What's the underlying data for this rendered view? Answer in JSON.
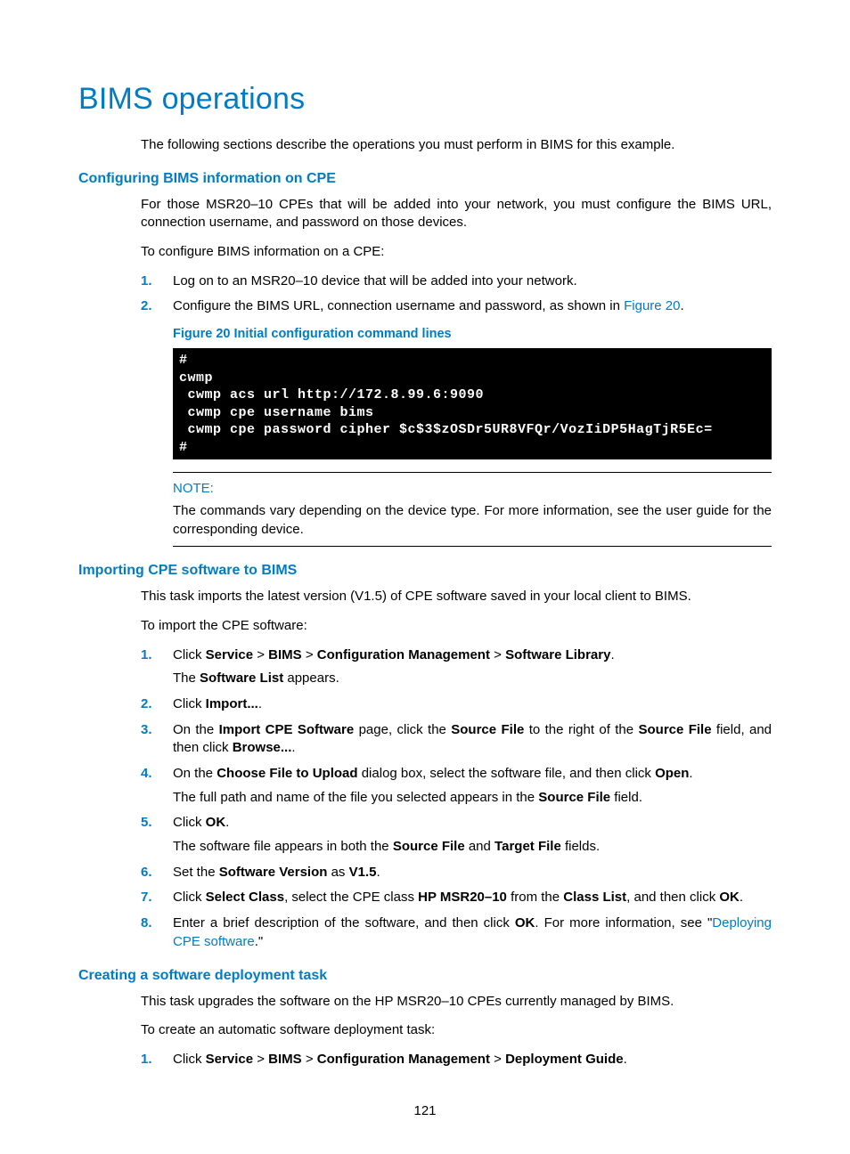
{
  "title": "BIMS operations",
  "intro": "The following sections describe the operations you must perform in BIMS for this example.",
  "sec1": {
    "heading": "Configuring BIMS information on CPE",
    "p1": "For those MSR20–10 CPEs that will be added into your network, you must configure the BIMS URL, connection username, and password on those devices.",
    "p2": "To configure BIMS information on a CPE:",
    "li1": "Log on to an MSR20–10 device that will be added into your network.",
    "li2_pre": "Configure the BIMS URL, connection username and password, as shown in ",
    "li2_link": "Figure 20",
    "li2_post": ".",
    "fig_caption": "Figure 20 Initial configuration command lines",
    "terminal": "#\ncwmp\n cwmp acs url http://172.8.99.6:9090\n cwmp cpe username bims\n cwmp cpe password cipher $c$3$zOSDr5UR8VFQr/VozIiDP5HagTjR5Ec=\n#",
    "note_label": "NOTE:",
    "note_text": "The commands vary depending on the device type. For more information, see the user guide for the corresponding device."
  },
  "sec2": {
    "heading": "Importing CPE software to BIMS",
    "p1": "This task imports the latest version (V1.5) of CPE software saved in your local client to BIMS.",
    "p2": "To import the CPE software:",
    "li1": {
      "pre": "Click ",
      "b1": "Service",
      "s1": " > ",
      "b2": "BIMS",
      "s2": " > ",
      "b3": "Configuration Management",
      "s3": " > ",
      "b4": "Software Library",
      "post": ".",
      "sub_pre": "The ",
      "sub_b": "Software List",
      "sub_post": " appears."
    },
    "li2": {
      "pre": "Click ",
      "b1": "Import...",
      "post": "."
    },
    "li3": {
      "pre": "On the ",
      "b1": "Import CPE Software",
      "mid1": " page, click the ",
      "b2": "Source File",
      "mid2": " to the right of the ",
      "b3": "Source File",
      "mid3": " field, and then click ",
      "b4": "Browse...",
      "post": "."
    },
    "li4": {
      "pre": "On the ",
      "b1": "Choose File to Upload",
      "mid1": " dialog box, select the software file, and then click ",
      "b2": "Open",
      "post": ".",
      "sub_pre": "The full path and name of the file you selected appears in the ",
      "sub_b": "Source File",
      "sub_post": " field."
    },
    "li5": {
      "pre": "Click ",
      "b1": "OK",
      "post": ".",
      "sub_pre": "The software file appears in both the ",
      "sub_b1": "Source File",
      "sub_mid": " and ",
      "sub_b2": "Target File",
      "sub_post": " fields."
    },
    "li6": {
      "pre": "Set the ",
      "b1": "Software Version",
      "mid": " as ",
      "b2": "V1.5",
      "post": "."
    },
    "li7": {
      "pre": "Click ",
      "b1": "Select Class",
      "mid1": ", select the CPE class ",
      "b2": "HP MSR20–10",
      "mid2": " from the ",
      "b3": "Class List",
      "mid3": ", and then click ",
      "b4": "OK",
      "post": "."
    },
    "li8": {
      "pre": "Enter a brief description of the software, and then click ",
      "b1": "OK",
      "mid": ". For more information, see \"",
      "link": "Deploying CPE software",
      "post": ".\""
    }
  },
  "sec3": {
    "heading": "Creating a software deployment task",
    "p1": "This task upgrades the software on the HP MSR20–10 CPEs currently managed by BIMS.",
    "p2": "To create an automatic software deployment task:",
    "li1": {
      "pre": "Click ",
      "b1": "Service",
      "s1": " > ",
      "b2": "BIMS",
      "s2": " > ",
      "b3": "Configuration Management",
      "s3": " > ",
      "b4": "Deployment Guide",
      "post": "."
    }
  },
  "page_number": "121"
}
